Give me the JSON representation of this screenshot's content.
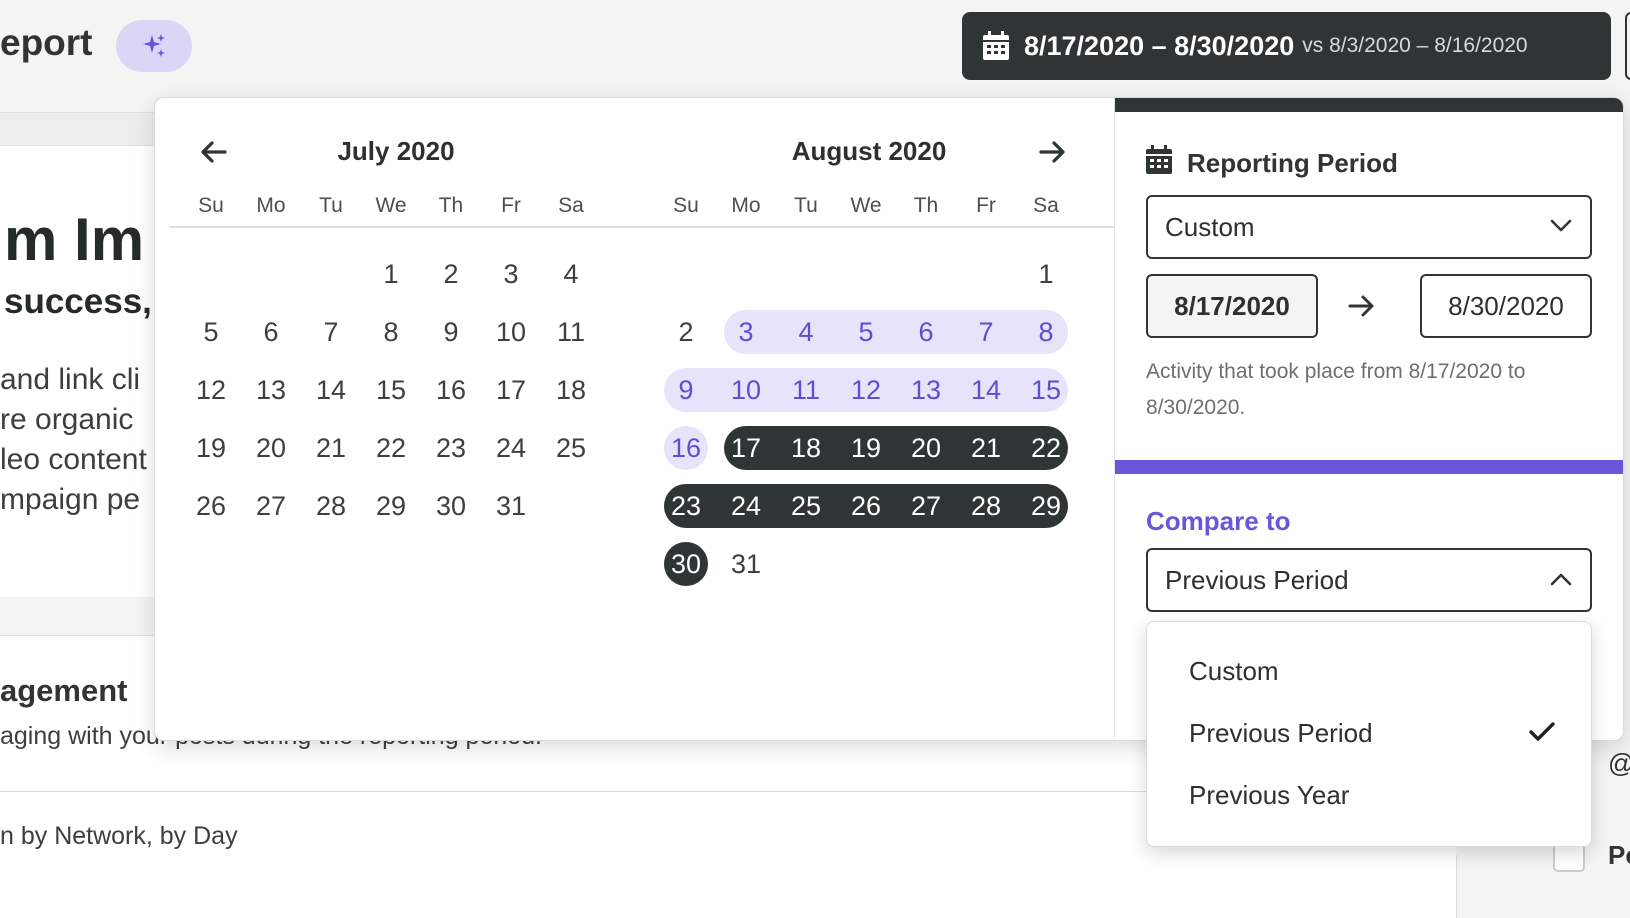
{
  "header": {
    "title_partial": "eport",
    "ai_icon": "sparkle-icon"
  },
  "background": {
    "heading_partial": "m Im",
    "subheading_partial": "success,",
    "lines": [
      "and link cli",
      "re organic",
      "leo content",
      "mpaign pe"
    ],
    "engagement_title": "agement",
    "engagement_sub": "aging with your posts during the reporting period.",
    "network_label": "n by Network, by Day",
    "right_at": "@",
    "right_p": "Po"
  },
  "date_range_button": {
    "icon": "calendar-icon",
    "range": "8/17/2020 – 8/30/2020",
    "compare_text": "vs 8/3/2020 – 8/16/2020",
    "color": "#2f3535"
  },
  "calendar": {
    "weekday_labels": [
      "Su",
      "Mo",
      "Tu",
      "We",
      "Th",
      "Fr",
      "Sa"
    ],
    "months": [
      {
        "title": "July 2020",
        "weeks": [
          [
            "",
            "",
            "",
            "1",
            "2",
            "3",
            "4"
          ],
          [
            "5",
            "6",
            "7",
            "8",
            "9",
            "10",
            "11"
          ],
          [
            "12",
            "13",
            "14",
            "15",
            "16",
            "17",
            "18"
          ],
          [
            "19",
            "20",
            "21",
            "22",
            "23",
            "24",
            "25"
          ],
          [
            "26",
            "27",
            "28",
            "29",
            "30",
            "31",
            ""
          ]
        ]
      },
      {
        "title": "August 2020",
        "weeks": [
          [
            "",
            "",
            "",
            "",
            "",
            "",
            "1"
          ],
          [
            "2",
            "3",
            "4",
            "5",
            "6",
            "7",
            "8"
          ],
          [
            "9",
            "10",
            "11",
            "12",
            "13",
            "14",
            "15"
          ],
          [
            "16",
            "17",
            "18",
            "19",
            "20",
            "21",
            "22"
          ],
          [
            "23",
            "24",
            "25",
            "26",
            "27",
            "28",
            "29"
          ],
          [
            "30",
            "31",
            "",
            "",
            "",
            "",
            ""
          ]
        ],
        "compare_days": [
          "3",
          "4",
          "5",
          "6",
          "7",
          "8",
          "9",
          "10",
          "11",
          "12",
          "13",
          "14",
          "15",
          "16"
        ],
        "selected_days": [
          "17",
          "18",
          "19",
          "20",
          "21",
          "22",
          "23",
          "24",
          "25",
          "26",
          "27",
          "28",
          "29",
          "30"
        ]
      }
    ],
    "prev_icon": "arrow-left-icon",
    "next_icon": "arrow-right-icon",
    "compare_color": "#e7e3fb",
    "compare_text_color": "#5c4fd2",
    "selected_color": "#2f3535"
  },
  "reporting_period": {
    "title": "Reporting Period",
    "icon": "calendar-icon",
    "selected": "Custom",
    "start_date": "8/17/2020",
    "end_date": "8/30/2020",
    "activity_text": "Activity that took place from 8/17/2020 to 8/30/2020."
  },
  "compare_to": {
    "title": "Compare to",
    "selected": "Previous Period",
    "options": [
      {
        "label": "Custom",
        "checked": false
      },
      {
        "label": "Previous Period",
        "checked": true
      },
      {
        "label": "Previous Year",
        "checked": false
      }
    ],
    "accent": "#6956d8"
  }
}
